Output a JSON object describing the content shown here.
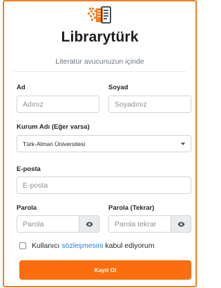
{
  "brand": {
    "name": "Librarytürk",
    "tagline": "Literatür avucunuzun içinde"
  },
  "form": {
    "first_name": {
      "label": "Ad",
      "placeholder": "Adınız"
    },
    "last_name": {
      "label": "Soyad",
      "placeholder": "Soyadınız"
    },
    "institution": {
      "label": "Kurum Adı (Eğer varsa)",
      "selected": "Türk-Alman Üniversitesi"
    },
    "email": {
      "label": "E-posta",
      "placeholder": "E-posta"
    },
    "password": {
      "label": "Parola",
      "placeholder": "Parola"
    },
    "password_confirm": {
      "label": "Parola (Tekrar)",
      "placeholder": "Parola tekrar"
    },
    "terms": {
      "prefix": "Kullanıcı",
      "link": "sözleşmesini",
      "suffix": "kabul ediyorum",
      "checked": false
    },
    "submit_label": "Kayıt Ol"
  },
  "colors": {
    "accent": "#fb6d0f",
    "frame": "#f47c20",
    "link": "#1e7be0",
    "logo_dark": "#2f3a46",
    "logo_orange": "#f47c20"
  },
  "icons": {
    "logo": "library-book-logo-icon",
    "toggle": "eye-icon",
    "dropdown": "chevron-down-icon"
  }
}
